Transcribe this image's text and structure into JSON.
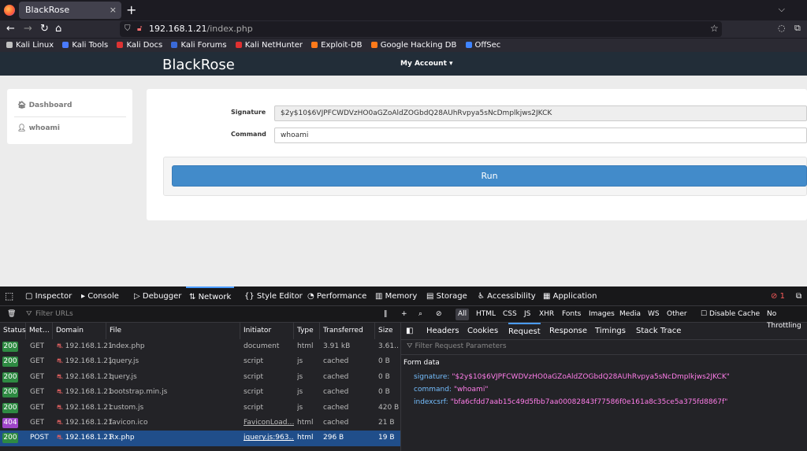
{
  "browser": {
    "tab_title": "BlackRose",
    "tab_close": "×",
    "new_tab": "+",
    "url_host": "192.168.1.21",
    "url_path": "/index.php",
    "bookmarks": [
      "Kali Linux",
      "Kali Tools",
      "Kali Docs",
      "Kali Forums",
      "Kali NetHunter",
      "Exploit-DB",
      "Google Hacking DB",
      "OffSec"
    ],
    "bookmark_colors": [
      "#c0c0c0",
      "#4a7bff",
      "#d33",
      "#3a6ad8",
      "#e03030",
      "#ff7a1a",
      "#ff7a1a",
      "#3f84ff"
    ]
  },
  "page": {
    "brand": "BlackRose",
    "my_account": "My Account ▾",
    "sidebar": {
      "dashboard": "Dashboard",
      "whoami": "whoami"
    },
    "form": {
      "signature_label": "Signature",
      "signature_value": "$2y$10$6VJPFCWDVzHO0aGZoAldZOGbdQ28AUhRvpya5sNcDmplkjws2JKCK",
      "command_label": "Command",
      "command_value": "whoami",
      "run_label": "Run"
    }
  },
  "devtools": {
    "tabs": [
      "Inspector",
      "Console",
      "Debugger",
      "Network",
      "Style Editor",
      "Performance",
      "Memory",
      "Storage",
      "Accessibility",
      "Application"
    ],
    "active_tab": "Network",
    "error_count": "1",
    "filter_placeholder": "Filter URLs",
    "filters": [
      "All",
      "HTML",
      "CSS",
      "JS",
      "XHR",
      "Fonts",
      "Images",
      "Media",
      "WS",
      "Other"
    ],
    "disable_cache": "Disable Cache",
    "throttling": "No Throttling",
    "columns": [
      "Status",
      "Met…",
      "Domain",
      "File",
      "Initiator",
      "Type",
      "Transferred",
      "Size"
    ],
    "rows": [
      {
        "status": "200",
        "method": "GET",
        "domain": "192.168.1.21",
        "file": "index.php",
        "initiator": "document",
        "type": "html",
        "transferred": "3.91 kB",
        "size": "3.61…"
      },
      {
        "status": "200",
        "method": "GET",
        "domain": "192.168.1.21",
        "file": "jquery.js",
        "initiator": "script",
        "type": "js",
        "transferred": "cached",
        "size": "0 B"
      },
      {
        "status": "200",
        "method": "GET",
        "domain": "192.168.1.21",
        "file": "query.js",
        "initiator": "script",
        "type": "js",
        "transferred": "cached",
        "size": "0 B"
      },
      {
        "status": "200",
        "method": "GET",
        "domain": "192.168.1.21",
        "file": "bootstrap.min.js",
        "initiator": "script",
        "type": "js",
        "transferred": "cached",
        "size": "0 B"
      },
      {
        "status": "200",
        "method": "GET",
        "domain": "192.168.1.21",
        "file": "custom.js",
        "initiator": "script",
        "type": "js",
        "transferred": "cached",
        "size": "420 B"
      },
      {
        "status": "404",
        "method": "GET",
        "domain": "192.168.1.21",
        "file": "favicon.ico",
        "initiator": "FaviconLoad…",
        "type": "html",
        "transferred": "cached",
        "size": "21 B"
      },
      {
        "status": "200",
        "method": "POST",
        "domain": "192.168.1.21",
        "file": "Rx.php",
        "initiator": "jquery.js:963…",
        "type": "html",
        "transferred": "296 B",
        "size": "19 B"
      }
    ],
    "detail_tabs": [
      "Headers",
      "Cookies",
      "Request",
      "Response",
      "Timings",
      "Stack Trace"
    ],
    "active_detail_tab": "Request",
    "filter_request_placeholder": "Filter Request Parameters",
    "form_data_label": "Form data",
    "form_data": [
      {
        "key": "signature:",
        "value": "\"$2y$10$6VJPFCWDVzHO0aGZoAldZOGbdQ28AUhRvpya5sNcDmplkjws2JKCK\""
      },
      {
        "key": "command:",
        "value": "\"whoami\""
      },
      {
        "key": "indexcsrf:",
        "value": "\"bfa6cfdd7aab15c49d5fbb7aa00082843f77586f0e161a8c35ce5a375fd8867f\""
      }
    ],
    "status_colors": {
      "200": "#2e8a42",
      "404": "#9f45c9"
    }
  }
}
